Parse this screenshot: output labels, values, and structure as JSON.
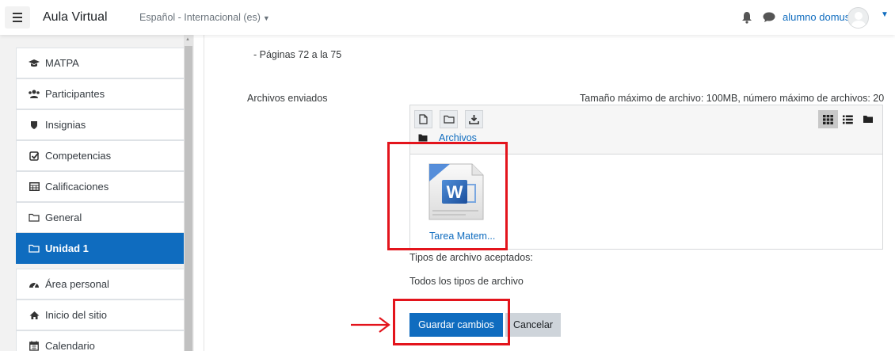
{
  "header": {
    "site_name": "Aula Virtual",
    "language": "Español - Internacional (es)",
    "username": "alumno domus"
  },
  "sidebar": {
    "items": [
      {
        "label": "MATPA",
        "icon": "graduation-cap-icon"
      },
      {
        "label": "Participantes",
        "icon": "users-icon"
      },
      {
        "label": "Insignias",
        "icon": "shield-icon"
      },
      {
        "label": "Competencias",
        "icon": "checkbox-icon"
      },
      {
        "label": "Calificaciones",
        "icon": "table-icon"
      },
      {
        "label": "General",
        "icon": "folder-icon"
      },
      {
        "label": "Unidad 1",
        "icon": "folder-icon",
        "active": true
      },
      {
        "label": "Área personal",
        "icon": "dashboard-icon"
      },
      {
        "label": "Inicio del sitio",
        "icon": "home-icon"
      },
      {
        "label": "Calendario",
        "icon": "calendar-icon"
      }
    ]
  },
  "main": {
    "pages_text": "- Páginas 72 a la 75",
    "files_label": "Archivos enviados",
    "limits_text": "Tamaño máximo de archivo: 100MB, número máximo de archivos: 20",
    "filemanager": {
      "breadcrumb": "Archivos",
      "files": [
        {
          "name": "Tarea Matem...",
          "icon": "word-document-icon"
        }
      ]
    },
    "accepted_label": "Tipos de archivo aceptados:",
    "accepted_value": "Todos los tipos de archivo",
    "save_label": "Guardar cambios",
    "cancel_label": "Cancelar"
  },
  "colors": {
    "primary": "#0f6cbf",
    "annotation": "#e3141c",
    "drawer_bg": "#f2f2f2"
  }
}
